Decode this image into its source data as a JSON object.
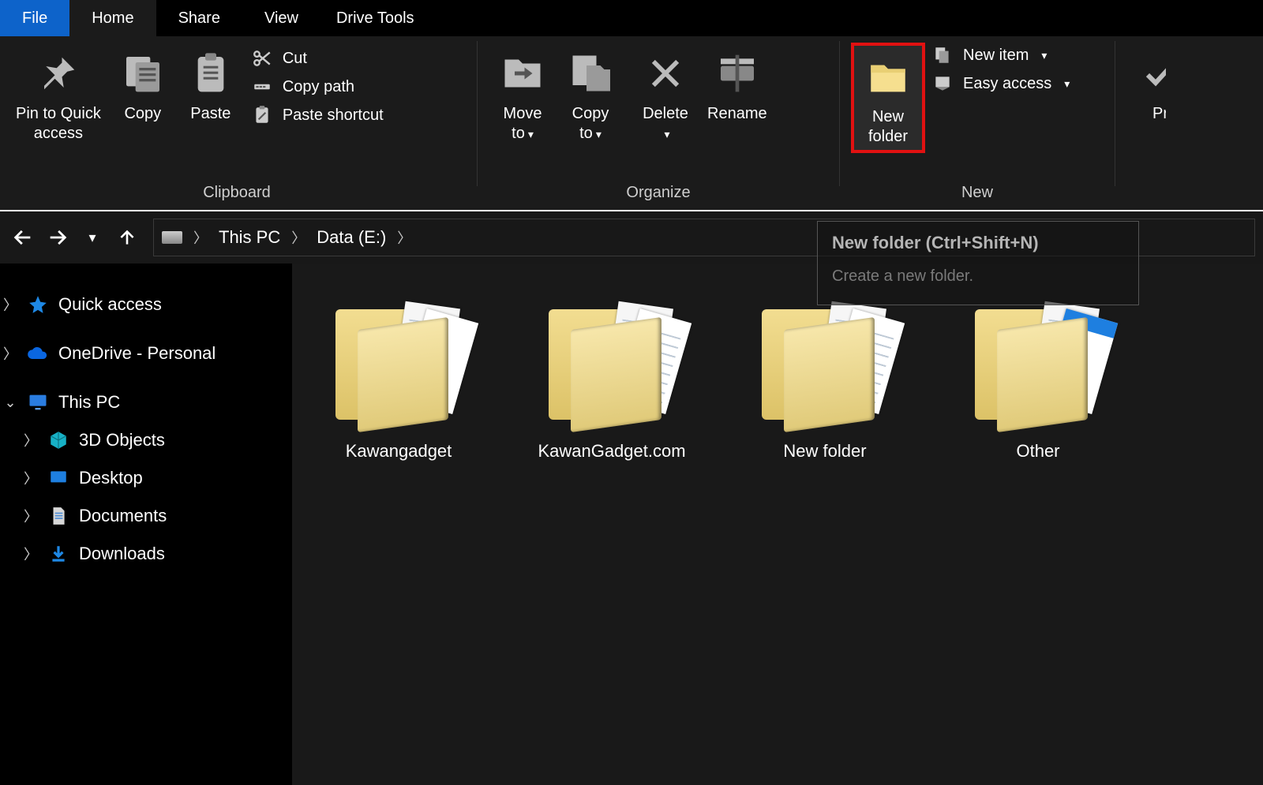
{
  "tabs": {
    "file": "File",
    "home": "Home",
    "share": "Share",
    "view": "View",
    "tools": "Drive Tools"
  },
  "ribbon": {
    "clipboard": {
      "label": "Clipboard",
      "pin": "Pin to Quick\naccess",
      "copy": "Copy",
      "paste": "Paste",
      "cut": "Cut",
      "copy_path": "Copy path",
      "paste_shortcut": "Paste shortcut"
    },
    "organize": {
      "label": "Organize",
      "move": "Move\nto",
      "copy": "Copy\nto",
      "delete": "Delete",
      "rename": "Rename"
    },
    "new": {
      "label": "New",
      "new_folder": "New\nfolder",
      "new_item": "New item",
      "easy_access": "Easy access"
    },
    "properties_partial": "Pr"
  },
  "tooltip": {
    "title": "New folder (Ctrl+Shift+N)",
    "body": "Create a new folder."
  },
  "breadcrumb": {
    "this_pc": "This PC",
    "drive": "Data (E:)"
  },
  "sidebar": {
    "quick_access": "Quick access",
    "onedrive": "OneDrive - Personal",
    "this_pc": "This PC",
    "objects3d": "3D Objects",
    "desktop": "Desktop",
    "documents": "Documents",
    "downloads": "Downloads"
  },
  "items": [
    {
      "name": "Kawangadget"
    },
    {
      "name": "KawanGadget.com"
    },
    {
      "name": "New folder"
    },
    {
      "name": "Other"
    }
  ]
}
